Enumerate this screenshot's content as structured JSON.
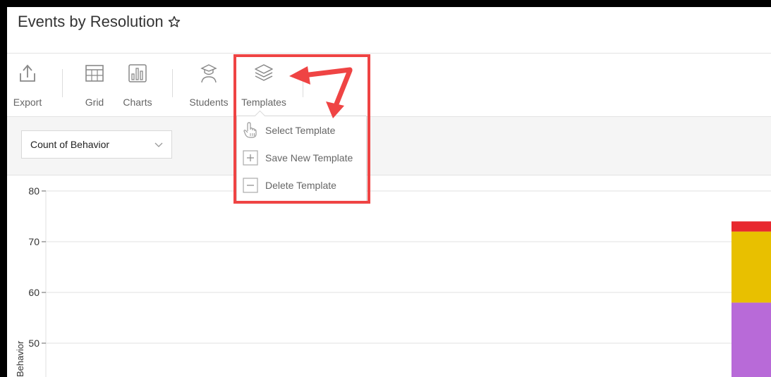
{
  "header": {
    "title": "Events by Resolution"
  },
  "toolbar": {
    "export_label": "Export",
    "grid_label": "Grid",
    "charts_label": "Charts",
    "students_label": "Students",
    "templates_label": "Templates"
  },
  "filter": {
    "metric_value": "Count of Behavior"
  },
  "templates_menu": {
    "items": [
      {
        "label": "Select Template",
        "icon": "hand-pointer-icon"
      },
      {
        "label": "Save New Template",
        "icon": "plus-box-icon"
      },
      {
        "label": "Delete Template",
        "icon": "minus-box-icon"
      }
    ]
  },
  "colors": {
    "annotation": "#ef4444",
    "series_red": "#e8282e",
    "series_yellow": "#e8c000",
    "series_purple": "#b86ad8"
  },
  "chart_data": {
    "type": "bar",
    "ylabel": "Behavior",
    "ylim": [
      43,
      80
    ],
    "yticks": [
      50,
      60,
      70,
      80
    ],
    "grid": true,
    "stacked_bar_partial": [
      {
        "name": "",
        "from": 0,
        "to": 58,
        "color": "#b86ad8"
      },
      {
        "name": "",
        "from": 58,
        "to": 72,
        "color": "#e8c000"
      },
      {
        "name": "",
        "from": 72,
        "to": 74,
        "color": "#e8282e"
      }
    ]
  }
}
